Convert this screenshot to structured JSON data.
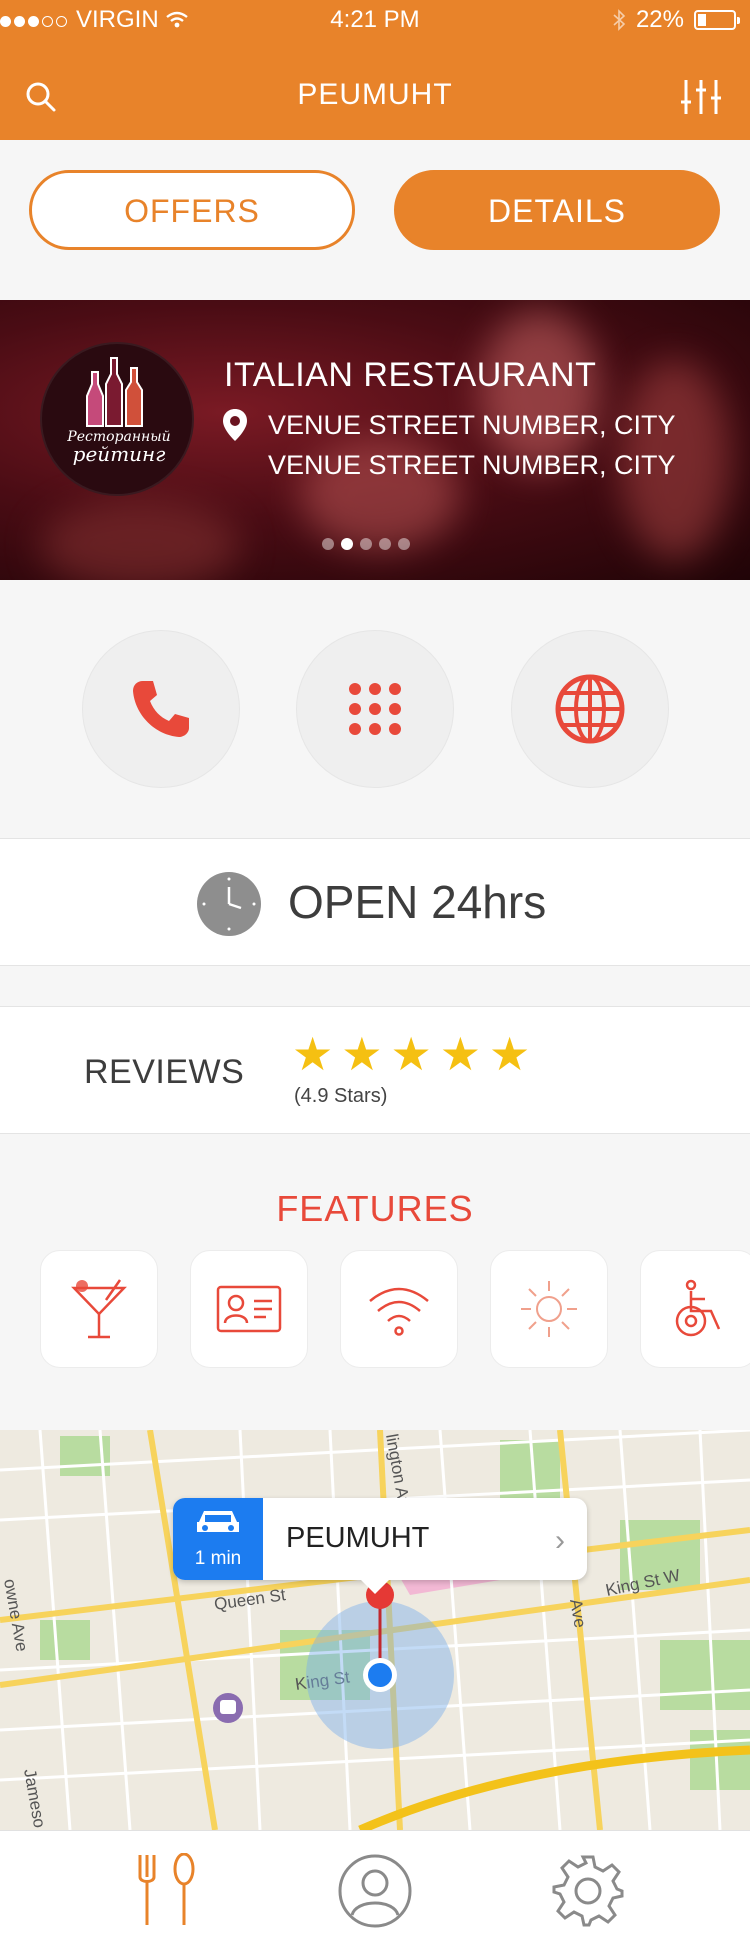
{
  "status_bar": {
    "carrier": "VIRGIN",
    "time": "4:21 PM",
    "battery": "22%"
  },
  "nav": {
    "title": "PEUMUHT"
  },
  "segments": {
    "offers": "OFFERS",
    "details": "DETAILS"
  },
  "restaurant": {
    "name": "ITALIAN RESTAURANT",
    "address_line1": "VENUE STREET NUMBER, CITY",
    "address_line2": "VENUE STREET NUMBER, CITY",
    "logo_text_line1": "Ресторанный",
    "logo_text_line2": "рейтинг",
    "carousel_pages": 5,
    "carousel_active": 2
  },
  "hours": {
    "label": "OPEN 24hrs"
  },
  "reviews": {
    "label": "REVIEWS",
    "stars": 5,
    "rating_text": "(4.9 Stars)"
  },
  "features": {
    "title": "FEATURES",
    "items": [
      "cocktail-icon",
      "id-card-icon",
      "wifi-icon",
      "sun-icon",
      "wheelchair-icon"
    ]
  },
  "map": {
    "popup_time": "1 min",
    "popup_title": "PEUMUHT",
    "streets": [
      "Queen St",
      "King St",
      "King St W",
      "Ave",
      "lington Ave",
      "Jameso",
      "owne Ave"
    ]
  },
  "tabs": [
    "food-icon",
    "profile-icon",
    "settings-icon"
  ],
  "colors": {
    "accent": "#e8832a",
    "red": "#e8493a",
    "star": "#f5c012",
    "map_blue": "#1c7cf0"
  }
}
